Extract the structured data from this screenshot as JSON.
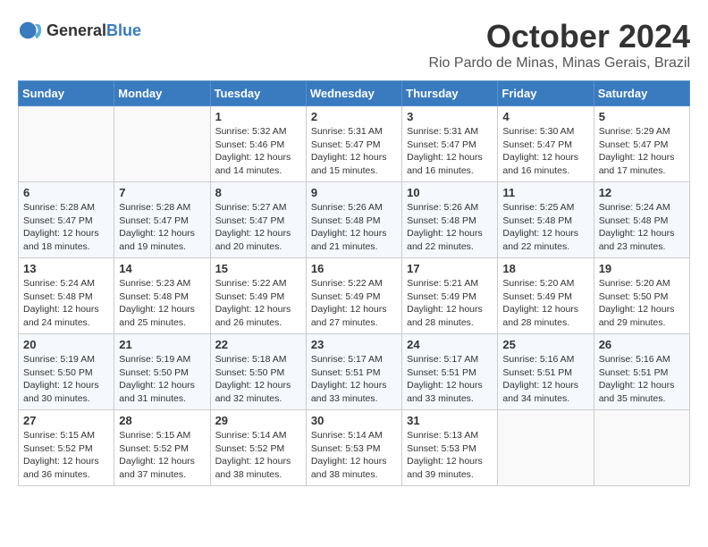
{
  "header": {
    "logo_general": "General",
    "logo_blue": "Blue",
    "month": "October 2024",
    "location": "Rio Pardo de Minas, Minas Gerais, Brazil"
  },
  "weekdays": [
    "Sunday",
    "Monday",
    "Tuesday",
    "Wednesday",
    "Thursday",
    "Friday",
    "Saturday"
  ],
  "weeks": [
    [
      {
        "day": "",
        "sunrise": "",
        "sunset": "",
        "daylight": ""
      },
      {
        "day": "",
        "sunrise": "",
        "sunset": "",
        "daylight": ""
      },
      {
        "day": "1",
        "sunrise": "Sunrise: 5:32 AM",
        "sunset": "Sunset: 5:46 PM",
        "daylight": "Daylight: 12 hours and 14 minutes."
      },
      {
        "day": "2",
        "sunrise": "Sunrise: 5:31 AM",
        "sunset": "Sunset: 5:47 PM",
        "daylight": "Daylight: 12 hours and 15 minutes."
      },
      {
        "day": "3",
        "sunrise": "Sunrise: 5:31 AM",
        "sunset": "Sunset: 5:47 PM",
        "daylight": "Daylight: 12 hours and 16 minutes."
      },
      {
        "day": "4",
        "sunrise": "Sunrise: 5:30 AM",
        "sunset": "Sunset: 5:47 PM",
        "daylight": "Daylight: 12 hours and 16 minutes."
      },
      {
        "day": "5",
        "sunrise": "Sunrise: 5:29 AM",
        "sunset": "Sunset: 5:47 PM",
        "daylight": "Daylight: 12 hours and 17 minutes."
      }
    ],
    [
      {
        "day": "6",
        "sunrise": "Sunrise: 5:28 AM",
        "sunset": "Sunset: 5:47 PM",
        "daylight": "Daylight: 12 hours and 18 minutes."
      },
      {
        "day": "7",
        "sunrise": "Sunrise: 5:28 AM",
        "sunset": "Sunset: 5:47 PM",
        "daylight": "Daylight: 12 hours and 19 minutes."
      },
      {
        "day": "8",
        "sunrise": "Sunrise: 5:27 AM",
        "sunset": "Sunset: 5:47 PM",
        "daylight": "Daylight: 12 hours and 20 minutes."
      },
      {
        "day": "9",
        "sunrise": "Sunrise: 5:26 AM",
        "sunset": "Sunset: 5:48 PM",
        "daylight": "Daylight: 12 hours and 21 minutes."
      },
      {
        "day": "10",
        "sunrise": "Sunrise: 5:26 AM",
        "sunset": "Sunset: 5:48 PM",
        "daylight": "Daylight: 12 hours and 22 minutes."
      },
      {
        "day": "11",
        "sunrise": "Sunrise: 5:25 AM",
        "sunset": "Sunset: 5:48 PM",
        "daylight": "Daylight: 12 hours and 22 minutes."
      },
      {
        "day": "12",
        "sunrise": "Sunrise: 5:24 AM",
        "sunset": "Sunset: 5:48 PM",
        "daylight": "Daylight: 12 hours and 23 minutes."
      }
    ],
    [
      {
        "day": "13",
        "sunrise": "Sunrise: 5:24 AM",
        "sunset": "Sunset: 5:48 PM",
        "daylight": "Daylight: 12 hours and 24 minutes."
      },
      {
        "day": "14",
        "sunrise": "Sunrise: 5:23 AM",
        "sunset": "Sunset: 5:48 PM",
        "daylight": "Daylight: 12 hours and 25 minutes."
      },
      {
        "day": "15",
        "sunrise": "Sunrise: 5:22 AM",
        "sunset": "Sunset: 5:49 PM",
        "daylight": "Daylight: 12 hours and 26 minutes."
      },
      {
        "day": "16",
        "sunrise": "Sunrise: 5:22 AM",
        "sunset": "Sunset: 5:49 PM",
        "daylight": "Daylight: 12 hours and 27 minutes."
      },
      {
        "day": "17",
        "sunrise": "Sunrise: 5:21 AM",
        "sunset": "Sunset: 5:49 PM",
        "daylight": "Daylight: 12 hours and 28 minutes."
      },
      {
        "day": "18",
        "sunrise": "Sunrise: 5:20 AM",
        "sunset": "Sunset: 5:49 PM",
        "daylight": "Daylight: 12 hours and 28 minutes."
      },
      {
        "day": "19",
        "sunrise": "Sunrise: 5:20 AM",
        "sunset": "Sunset: 5:50 PM",
        "daylight": "Daylight: 12 hours and 29 minutes."
      }
    ],
    [
      {
        "day": "20",
        "sunrise": "Sunrise: 5:19 AM",
        "sunset": "Sunset: 5:50 PM",
        "daylight": "Daylight: 12 hours and 30 minutes."
      },
      {
        "day": "21",
        "sunrise": "Sunrise: 5:19 AM",
        "sunset": "Sunset: 5:50 PM",
        "daylight": "Daylight: 12 hours and 31 minutes."
      },
      {
        "day": "22",
        "sunrise": "Sunrise: 5:18 AM",
        "sunset": "Sunset: 5:50 PM",
        "daylight": "Daylight: 12 hours and 32 minutes."
      },
      {
        "day": "23",
        "sunrise": "Sunrise: 5:17 AM",
        "sunset": "Sunset: 5:51 PM",
        "daylight": "Daylight: 12 hours and 33 minutes."
      },
      {
        "day": "24",
        "sunrise": "Sunrise: 5:17 AM",
        "sunset": "Sunset: 5:51 PM",
        "daylight": "Daylight: 12 hours and 33 minutes."
      },
      {
        "day": "25",
        "sunrise": "Sunrise: 5:16 AM",
        "sunset": "Sunset: 5:51 PM",
        "daylight": "Daylight: 12 hours and 34 minutes."
      },
      {
        "day": "26",
        "sunrise": "Sunrise: 5:16 AM",
        "sunset": "Sunset: 5:51 PM",
        "daylight": "Daylight: 12 hours and 35 minutes."
      }
    ],
    [
      {
        "day": "27",
        "sunrise": "Sunrise: 5:15 AM",
        "sunset": "Sunset: 5:52 PM",
        "daylight": "Daylight: 12 hours and 36 minutes."
      },
      {
        "day": "28",
        "sunrise": "Sunrise: 5:15 AM",
        "sunset": "Sunset: 5:52 PM",
        "daylight": "Daylight: 12 hours and 37 minutes."
      },
      {
        "day": "29",
        "sunrise": "Sunrise: 5:14 AM",
        "sunset": "Sunset: 5:52 PM",
        "daylight": "Daylight: 12 hours and 38 minutes."
      },
      {
        "day": "30",
        "sunrise": "Sunrise: 5:14 AM",
        "sunset": "Sunset: 5:53 PM",
        "daylight": "Daylight: 12 hours and 38 minutes."
      },
      {
        "day": "31",
        "sunrise": "Sunrise: 5:13 AM",
        "sunset": "Sunset: 5:53 PM",
        "daylight": "Daylight: 12 hours and 39 minutes."
      },
      {
        "day": "",
        "sunrise": "",
        "sunset": "",
        "daylight": ""
      },
      {
        "day": "",
        "sunrise": "",
        "sunset": "",
        "daylight": ""
      }
    ]
  ]
}
